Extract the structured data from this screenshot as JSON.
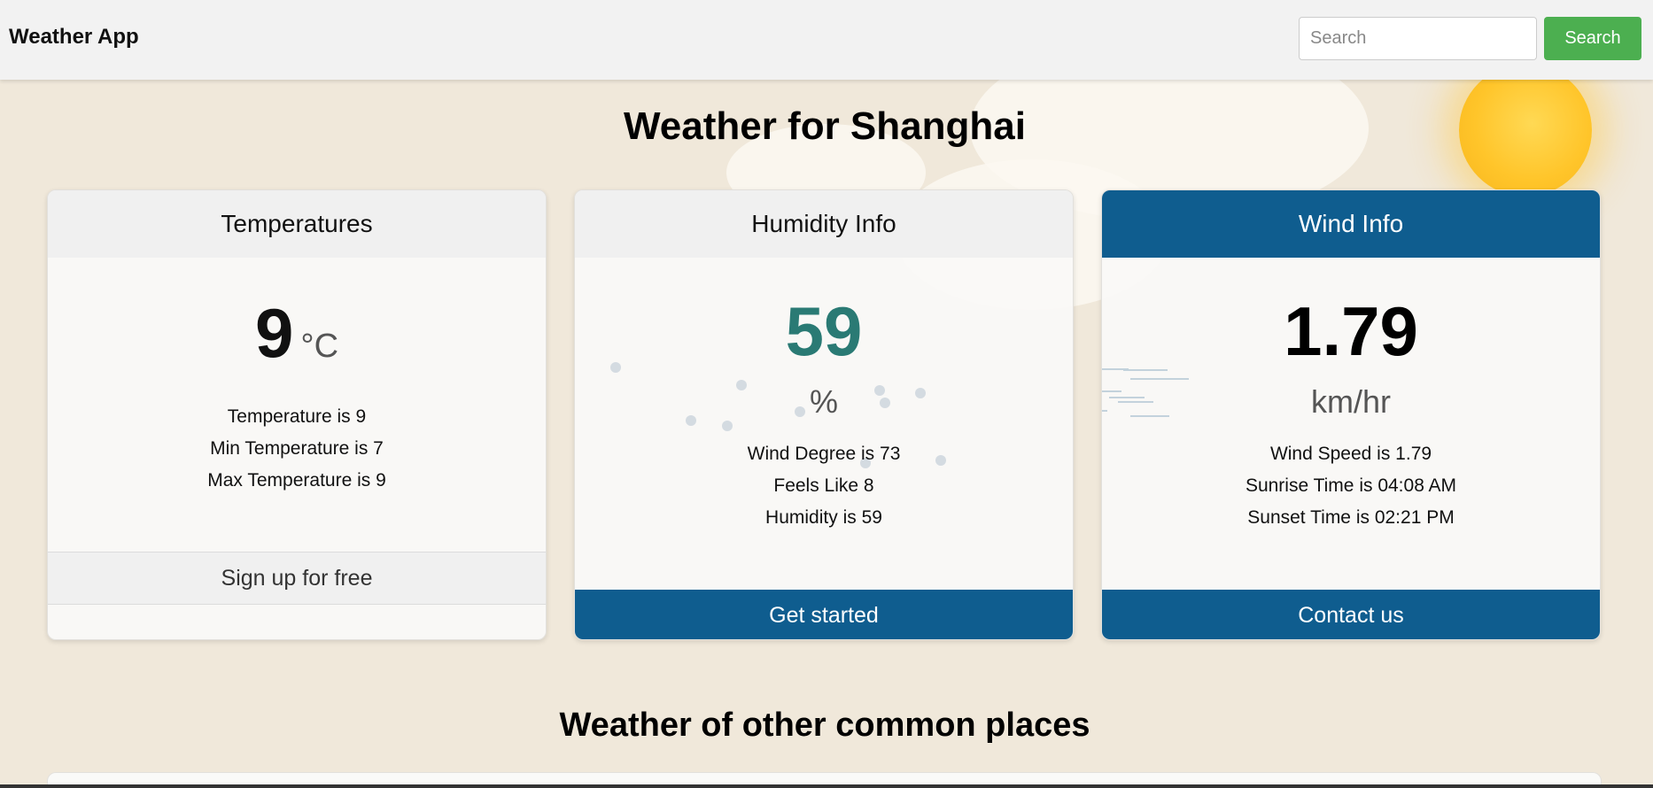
{
  "app": {
    "title": "Weather App"
  },
  "search": {
    "placeholder": "Search",
    "button_label": "Search"
  },
  "main": {
    "title": "Weather for Shanghai"
  },
  "cards": {
    "temperature": {
      "header": "Temperatures",
      "value": "9",
      "unit": "°C",
      "details": [
        "Temperature is 9",
        "Min Temperature is 7",
        "Max Temperature is 9"
      ],
      "footer": "Sign up for free"
    },
    "humidity": {
      "header": "Humidity Info",
      "value": "59",
      "unit": "%",
      "details": [
        "Wind Degree is 73",
        "Feels Like 8",
        "Humidity is 59"
      ],
      "footer": "Get started"
    },
    "wind": {
      "header": "Wind Info",
      "value": "1.79",
      "unit": "km/hr",
      "details": [
        "Wind Speed is 1.79",
        "Sunrise Time is 04:08 AM",
        "Sunset Time is 02:21 PM"
      ],
      "footer": "Contact us"
    }
  },
  "other_places": {
    "title": "Weather of other common places"
  },
  "colors": {
    "accent_blue": "#0f5d8f",
    "search_green": "#4caf50",
    "humidity_teal": "#2a7a74",
    "background": "#f0e8da"
  },
  "icons": {
    "sun": "sun-icon",
    "clouds": "cloud-icon",
    "rain": "raindrop-icon",
    "wind": "wind-lines-icon"
  }
}
